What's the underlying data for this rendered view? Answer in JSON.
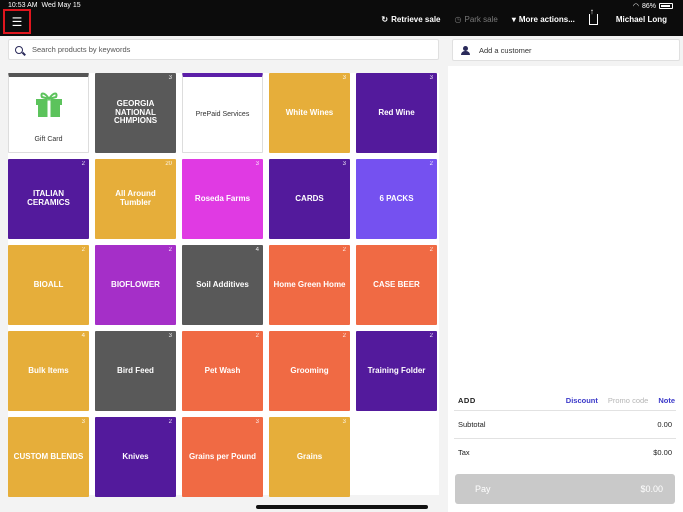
{
  "status": {
    "time": "10:53 AM",
    "date": "Wed May 15",
    "battery": "86%"
  },
  "topbar": {
    "retrieve_sale": "Retrieve sale",
    "park_sale": "Park sale",
    "more_actions": "More actions...",
    "user": "Michael Long"
  },
  "search": {
    "placeholder": "Search products by keywords"
  },
  "tiles": [
    {
      "label": "Gift Card",
      "count": "",
      "color": "white",
      "kind": "gift"
    },
    {
      "label": "GEORGIA NATIONAL CHMPIONS",
      "count": "3",
      "color": "#595959"
    },
    {
      "label": "PrePaid Services",
      "count": "",
      "color": "white",
      "kind": "prepaid"
    },
    {
      "label": "White Wines",
      "count": "3",
      "color": "#e6ae3a"
    },
    {
      "label": "Red Wine",
      "count": "3",
      "color": "#531a9c"
    },
    {
      "label": "ITALIAN CERAMICS",
      "count": "2",
      "color": "#531a9c"
    },
    {
      "label": "All Around Tumbler",
      "count": "20",
      "color": "#e6ae3a"
    },
    {
      "label": "Roseda Farms",
      "count": "3",
      "color": "#e03ae3"
    },
    {
      "label": "CARDS",
      "count": "3",
      "color": "#531a9c"
    },
    {
      "label": "6 PACKS",
      "count": "2",
      "color": "#7551f0"
    },
    {
      "label": "BIOALL",
      "count": "2",
      "color": "#e6ae3a"
    },
    {
      "label": "BIOFLOWER",
      "count": "2",
      "color": "#a52fc8"
    },
    {
      "label": "Soil Additives",
      "count": "4",
      "color": "#595959"
    },
    {
      "label": "Home Green Home",
      "count": "2",
      "color": "#f06a44"
    },
    {
      "label": "CASE BEER",
      "count": "2",
      "color": "#f06a44"
    },
    {
      "label": "Bulk Items",
      "count": "4",
      "color": "#e6ae3a"
    },
    {
      "label": "Bird Feed",
      "count": "3",
      "color": "#595959"
    },
    {
      "label": "Pet Wash",
      "count": "2",
      "color": "#f06a44"
    },
    {
      "label": "Grooming",
      "count": "2",
      "color": "#f06a44"
    },
    {
      "label": "Training Folder",
      "count": "2",
      "color": "#531a9c"
    },
    {
      "label": "CUSTOM BLENDS",
      "count": "3",
      "color": "#e6ae3a"
    },
    {
      "label": "Knives",
      "count": "2",
      "color": "#531a9c"
    },
    {
      "label": "Grains per Pound",
      "count": "3",
      "color": "#f06a44"
    },
    {
      "label": "Grains",
      "count": "3",
      "color": "#e6ae3a"
    }
  ],
  "customer": {
    "label": "Add a customer"
  },
  "sale": {
    "add_label": "ADD",
    "discount": "Discount",
    "promo_code": "Promo code",
    "note": "Note",
    "subtotal_label": "Subtotal",
    "subtotal_value": "0.00",
    "tax_label": "Tax",
    "tax_value": "$0.00",
    "pay_label": "Pay",
    "pay_amount": "$0.00"
  }
}
